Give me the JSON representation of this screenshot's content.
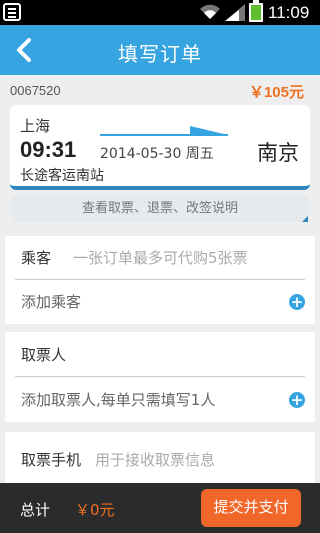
{
  "status_bar": {
    "time": "11:09",
    "wifi": "wifi-icon",
    "signal": "signal-icon",
    "battery": "battery-icon",
    "notification": "notification-icon"
  },
  "header": {
    "title": "填写订单",
    "back_icon": "back-arrow-icon"
  },
  "order": {
    "number": "0067520",
    "price": "￥105元"
  },
  "trip": {
    "from_city": "上海",
    "departure_time": "09:31",
    "date": "2014-05-30 周五",
    "to_city": "南京",
    "station": "长途客运南站",
    "arrow_icon": "direction-arrow-icon"
  },
  "notice": {
    "text": "查看取票、退票、改签说明"
  },
  "passenger": {
    "label": "乘客",
    "hint": "一张订单最多可代购5张票",
    "add_text": "添加乘客",
    "add_icon": "plus-icon"
  },
  "collector": {
    "label": "取票人",
    "add_text": "添加取票人,每单只需填写1人",
    "add_icon": "plus-icon"
  },
  "phone": {
    "label": "取票手机",
    "placeholder": "用于接收取票信息"
  },
  "footer": {
    "total_label": "总计",
    "total_value": "￥0元",
    "submit_label": "提交并支付"
  },
  "colors": {
    "accent": "#35a4e1",
    "price": "#f07021",
    "button": "#f1672a",
    "footer_bg": "#2b2b2b"
  }
}
